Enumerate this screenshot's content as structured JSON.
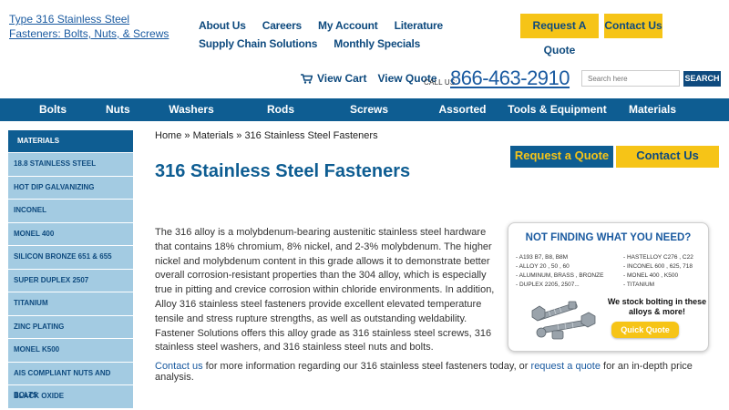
{
  "header": {
    "site_link": "Type 316 Stainless Steel Fasteners: Bolts, Nuts, & Screws",
    "top_nav": [
      "About Us",
      "Careers",
      "My Account",
      "Literature",
      "Supply Chain Solutions",
      "Monthly Specials"
    ],
    "request_quote_button": "Request A Quote",
    "contact_button": "Contact Us",
    "view_cart": "View Cart",
    "view_quote": "View Quote",
    "call_label": "CALL US:",
    "phone": "866-463-2910",
    "search_placeholder": "Search here",
    "search_button": "SEARCH"
  },
  "main_nav": [
    "Bolts",
    "Nuts",
    "Washers",
    "Rods And Studs",
    "Screws",
    "Assorted Fasteners",
    "Tools & Equipment",
    "Materials"
  ],
  "sidebar": {
    "heading": "MATERIALS",
    "items": [
      "18.8 STAINLESS STEEL",
      "HOT DIP GALVANIZING",
      "INCONEL",
      "MONEL 400",
      "SILICON BRONZE 651 & 655",
      "SUPER DUPLEX 2507",
      "TITANIUM",
      "ZINC PLATING",
      "MONEL K500",
      "AIS COMPLIANT NUTS AND BOLTS",
      "BLACK OXIDE"
    ]
  },
  "breadcrumb": {
    "home": "Home",
    "sep1": " » ",
    "materials": "Materials",
    "sep2": " » ",
    "current": "316 Stainless Steel Fasteners"
  },
  "page_title": "316 Stainless Steel Fasteners",
  "action_buttons": {
    "request": "Request a Quote",
    "contact": "Contact Us"
  },
  "body_text": "The 316 alloy is a molybdenum-bearing austenitic stainless steel hardware that contains 18% chromium, 8% nickel, and 2-3% molybdenum. The higher nickel and molybdenum content in this grade allows it to demonstrate better overall corrosion-resistant properties than the 304 alloy, which is especially true in pitting and crevice corrosion within chloride environments. In addition, Alloy 316 stainless steel fasteners provide excellent elevated temperature tensile and stress rupture strengths, as well as outstanding weldability. Fastener Solutions offers this alloy grade as 316 stainless steel screws, 316 stainless steel washers, and 316 stainless steel nuts and bolts.",
  "promo": {
    "heading": "NOT FINDING WHAT YOU NEED?",
    "left_list": [
      "- A193 B7, B8, B8M",
      "- ALLOY 20 , 50 , 60",
      "- ALUMINUM, BRASS , BRONZE",
      "- DUPLEX 2205, 2507..."
    ],
    "right_list": [
      "- HASTELLOY C276 , C22",
      "- INCONEL 600 , 625, 718",
      "- MONEL 400 , K500",
      "- TITANIUM"
    ],
    "message": "We stock bolting in these alloys & more!",
    "button": "Quick Quote"
  },
  "footer": {
    "contact_link": "Contact us",
    "middle": " for more information regarding our 316 stainless steel fasteners today, or ",
    "quote_link": "request a quote",
    "end": " for an in-depth price analysis."
  },
  "colors": {
    "brand_blue": "#0e5d92",
    "accent_yellow": "#f6c417",
    "sidebar_light": "#a3cbe2"
  }
}
